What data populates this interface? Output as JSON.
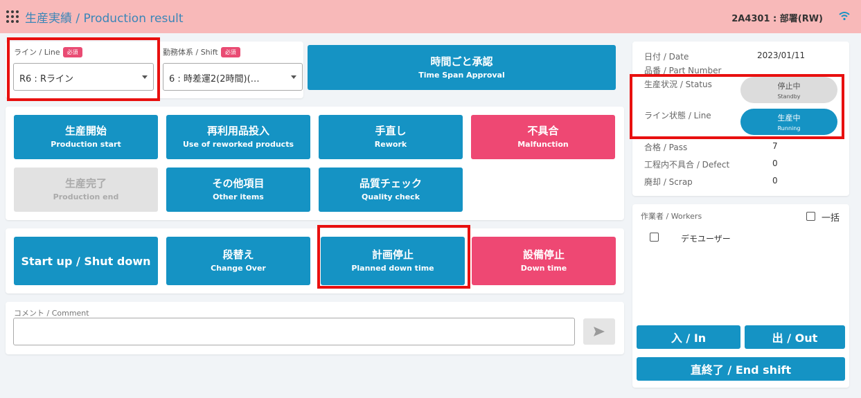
{
  "header": {
    "title": "生産実績 / Production result",
    "user": "2A4301 : 部署(RW)",
    "menu_icon": "grid-menu-icon",
    "signal_icon": "wifi-icon"
  },
  "form": {
    "line_label": "ライン / Line",
    "line_required": "必須",
    "line_value": "R6 : Rライン",
    "shift_label": "勤務体系 / Shift",
    "shift_required": "必須",
    "shift_value": "6 : 時差運2(2時間)(…"
  },
  "approval_button": {
    "jp": "時間ごと承認",
    "en": "Time Span Approval"
  },
  "actions": {
    "production_start": {
      "jp": "生産開始",
      "en": "Production start"
    },
    "reworked_products": {
      "jp": "再利用品投入",
      "en": "Use of reworked products"
    },
    "rework": {
      "jp": "手直し",
      "en": "Rework"
    },
    "malfunction": {
      "jp": "不具合",
      "en": "Malfunction"
    },
    "production_end": {
      "jp": "生産完了",
      "en": "Production end"
    },
    "other_items": {
      "jp": "その他項目",
      "en": "Other items"
    },
    "quality_check": {
      "jp": "品質チェック",
      "en": "Quality check"
    }
  },
  "downtime": {
    "startup": "Start up / Shut down",
    "changeover": {
      "jp": "段替え",
      "en": "Change Over"
    },
    "planned": {
      "jp": "計画停止",
      "en": "Planned down time"
    },
    "down": {
      "jp": "設備停止",
      "en": "Down time"
    }
  },
  "comment": {
    "label": "コメント / Comment",
    "value": "",
    "send_icon": "send-icon"
  },
  "info": {
    "date_label": "日付 / Date",
    "date_value": "2023/01/11",
    "part_label": "品番 / Part Number",
    "part_value": "",
    "status_label": "生産状況 / Status",
    "status_jp": "停止中",
    "status_en": "Standby",
    "line_label": "ライン状態 / Line",
    "line_jp": "生産中",
    "line_en": "Running",
    "pass_label": "合格 / Pass",
    "pass_value": "7",
    "defect_label": "工程内不具合 / Defect",
    "defect_value": "0",
    "scrap_label": "廃却 / Scrap",
    "scrap_value": "0"
  },
  "workers": {
    "label": "作業者 / Workers",
    "select_all": "一括",
    "items": [
      "デモユーザー"
    ],
    "in_button": "入 / In",
    "out_button": "出 / Out",
    "end_shift_button": "直終了 / End shift"
  },
  "colors": {
    "header_bg": "#f8b9b9",
    "primary": "#1593c4",
    "danger": "#ee4873",
    "highlight": "#e8100f"
  }
}
